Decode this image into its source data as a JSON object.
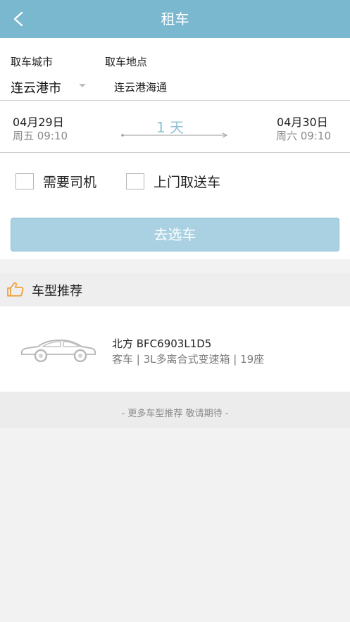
{
  "header": {
    "title": "租车"
  },
  "form": {
    "pickup_city_label": "取车城市",
    "pickup_location_label": "取车地点",
    "city": "连云港市",
    "location": "连云港海通",
    "start_date": "04月29日",
    "start_week_time": "周五 09:10",
    "duration": "1 天",
    "end_date": "04月30日",
    "end_week_time": "周六 09:10",
    "need_driver": "需要司机",
    "door_to_door": "上门取送车",
    "submit": "去选车"
  },
  "recommend": {
    "title": "车型推荐",
    "car_name": "北方 BFC6903L1D5",
    "car_spec": "客车 | 3L多离合式变速箱 | 19座",
    "more": "- 更多车型推荐 敬请期待 -"
  },
  "colors": {
    "header_bg": "#7ab8cf",
    "button_bg": "#a9d1e1",
    "thumb_icon": "#f0a23c"
  },
  "icons": [
    "back-arrow-icon",
    "chevron-down-icon",
    "thumbs-up-icon",
    "car-icon"
  ]
}
